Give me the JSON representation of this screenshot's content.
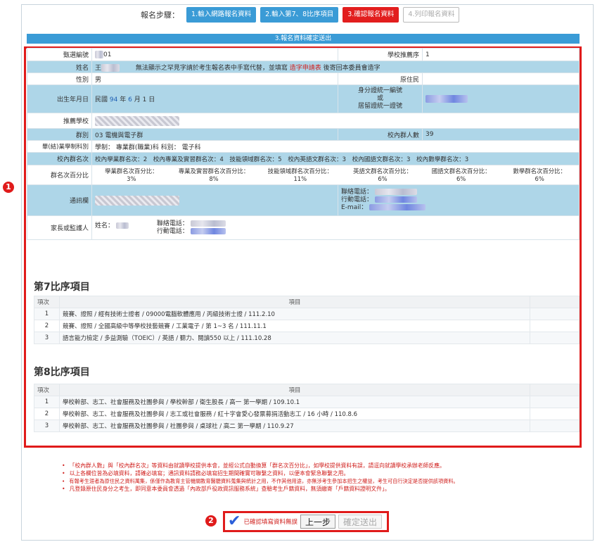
{
  "steps": {
    "label": "報名步驟：",
    "items": [
      {
        "label": "1.輸入網路報名資料",
        "state": "done"
      },
      {
        "label": "2.輸入第7、8比序項目",
        "state": "done"
      },
      {
        "label": "3.確認報名資料",
        "state": "current"
      },
      {
        "label": "4.列印報名資料",
        "state": "todo"
      }
    ]
  },
  "section_title": "3.報名資料確定送出",
  "info": {
    "exam_no_label": "甄選編號",
    "exam_no_value": "01",
    "school_rank_label": "學校推薦序",
    "school_rank_value": "1",
    "name_label": "姓名",
    "name_value": "王",
    "name_note_a": "無法顯示之罕見字請於考生報名表中手寫代替，並填寫",
    "name_note_link": "造字申請表",
    "name_note_b": "後寄回本委員會造字",
    "gender_label": "性別",
    "gender_value": "男",
    "aboriginal_label": "原住民",
    "aboriginal_value": "",
    "birth_label": "出生年月日",
    "birth_prefix": "民國",
    "birth_year": "94",
    "birth_y": "年",
    "birth_month": "6",
    "birth_m": "月",
    "birth_day": "1",
    "birth_d": "日",
    "id_label_1": "身分證統一編號",
    "id_label_2": "或",
    "id_label_3": "居留證統一證號",
    "rec_school_label": "推薦學校",
    "group_label": "群別",
    "group_value": "03 電機與電子群",
    "group_count_label": "校內群人數",
    "group_count_value": "39",
    "dept_label": "畢(結)業學制科別",
    "dept_value": "學制： 專業群(職業)科  科別： 電子科",
    "rank_label": "校內群名次",
    "rank_value": "校內學業群名次：2　校內專業及實習群名次：4　技能領域群名次：5　校內英語文群名次：3　校內國語文群名次：3　校內數學群名次：3",
    "pct_label": "群名次百分比",
    "pcts": [
      {
        "label": "學業群名次百分比：",
        "value": "3%"
      },
      {
        "label": "專業及實習群名次百分比：",
        "value": "8%"
      },
      {
        "label": "技能領域群名次百分比：",
        "value": "11%"
      },
      {
        "label": "英語文群名次百分比：",
        "value": "6%"
      },
      {
        "label": "國語文群名次百分比：",
        "value": "6%"
      },
      {
        "label": "數學群名次百分比：",
        "value": "6%"
      }
    ],
    "addr_label": "通訊欄",
    "contact_phone_label": "聯絡電話：",
    "mobile_label": "行動電話：",
    "email_label": "E-mail：",
    "guardian_label": "家長或監護人",
    "guardian_name_label": "姓名：",
    "guardian_phone_label": "聯絡電話：",
    "guardian_mobile_label": "行動電話："
  },
  "section7": {
    "title": "第7比序項目",
    "col_no": "項次",
    "col_item": "項目",
    "rows": [
      {
        "no": "1",
        "item": "競賽、證照 / 經有技術士證者 / 09000電腦軟體應用 / 丙級技術士證 / 111.2.10"
      },
      {
        "no": "2",
        "item": "競賽、證照 / 全國高級中等學校技藝競賽 / 工業電子 / 第 1~3 名 / 111.11.1"
      },
      {
        "no": "3",
        "item": "語言能力檢定 / 多益測驗（TOEIC）/ 英語 / 聽力、閱讀550 以上 / 111.10.28"
      }
    ]
  },
  "section8": {
    "title": "第8比序項目",
    "col_no": "項次",
    "col_item": "項目",
    "rows": [
      {
        "no": "1",
        "item": "學校幹部、志工、社會服務及社團參與 / 學校幹部 / 衛生股長 / 高一 第一學期 / 109.10.1"
      },
      {
        "no": "2",
        "item": "學校幹部、志工、社會服務及社團參與 / 志工或社會服務 / 紅十字會愛心發票募捐活動志工 / 16 小時 / 110.8.6"
      },
      {
        "no": "3",
        "item": "學校幹部、志工、社會服務及社團參與 / 社團參與 / 桌球社 / 高二 第一學期 / 110.9.27"
      }
    ]
  },
  "notes": [
    "「校內群人數」與「校內群名次」等資料由就讀學校提供本會，並經公式自動換算「群名次百分比」，如學校提供資料有誤，請逕向就讀學校承辦老師反應。",
    "以上各欄位皆為必填資料，請確必填寫；通訊資料請務必填寫招生期間確實可聯繫之資料，以便本會緊急聯繫之用。",
    "有報考生涯者為原住民之資料萬集，係僅作為教育主管機關教育醫聽資料蒐集與統計之用，不作其他用途，亦無涉考生參加本招生之權益，考生可自行決定是否提供該項資料。",
    "凡登錄原住民身分之考生，即同意本委員會透過「內政部戶役政資訊服務系統」查驗考生戶籍資料，無須繳寄「戶籍資料證明文件」。"
  ],
  "badges": {
    "one": "1",
    "two": "2"
  },
  "confirm": {
    "check_text": "已確認填寫資料無誤",
    "prev_label": "上一步",
    "submit_label": "確定送出"
  },
  "colors": {
    "accent": "#3a9bd6",
    "highlight": "#e01b1b",
    "row_blue": "#aed6e8"
  }
}
